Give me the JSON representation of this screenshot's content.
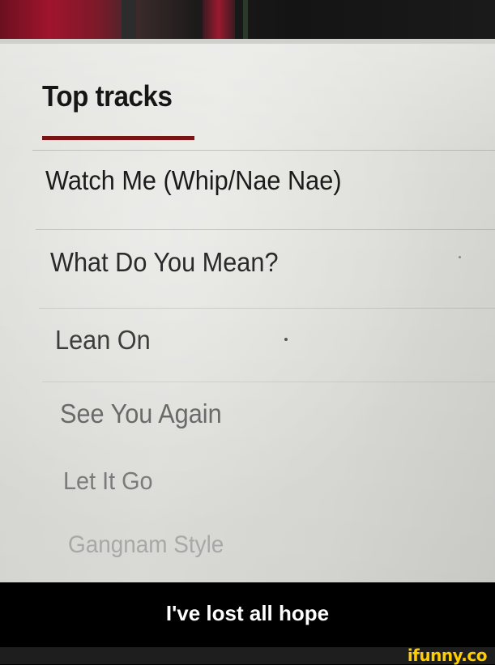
{
  "screen": {
    "heading": "Top tracks",
    "tracks": [
      "Watch Me (Whip/Nae Nae)",
      "What Do You Mean?",
      "Lean On",
      "See You Again",
      "Let It Go",
      "Gangnam Style"
    ]
  },
  "caption": "I've lost all hope",
  "watermark": "ifunny.co",
  "colors": {
    "underline": "#7a1414",
    "caption_text": "#ffffff",
    "logo": "#ffcc00"
  }
}
